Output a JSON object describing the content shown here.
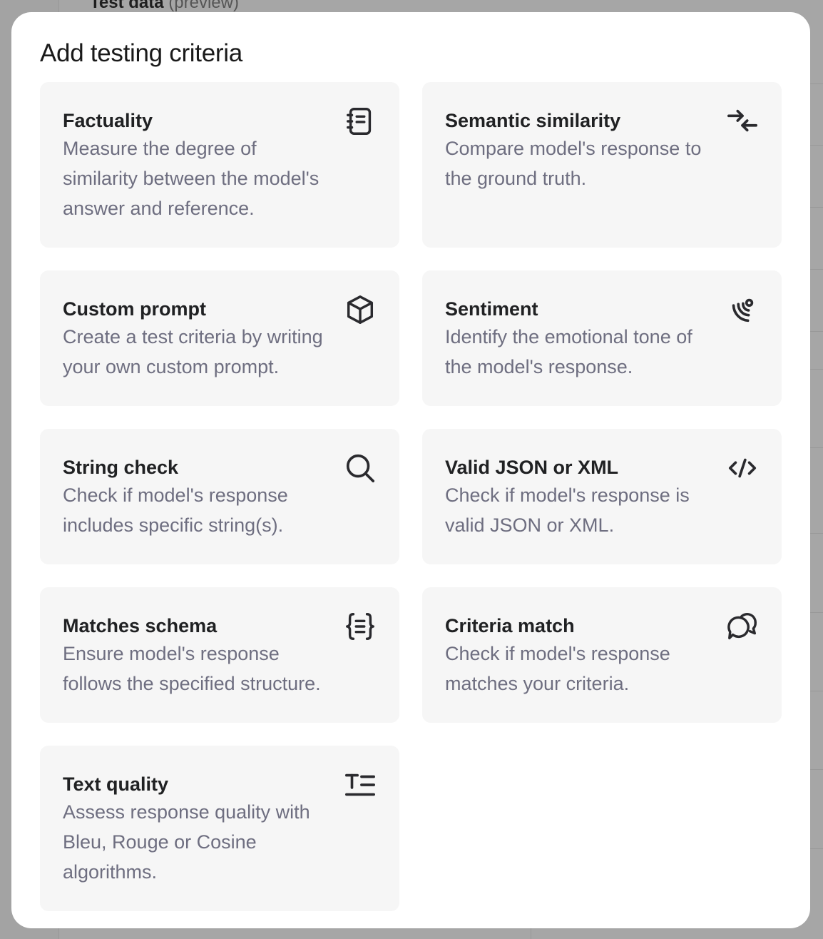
{
  "background": {
    "title": "Test data",
    "title_suffix": "(preview)"
  },
  "modal": {
    "title": "Add testing criteria",
    "cards": [
      {
        "title": "Factuality",
        "description": "Measure the degree of similarity between the model's answer and reference.",
        "icon": "notebook-icon"
      },
      {
        "title": "Semantic similarity",
        "description": "Compare model's response to the ground truth.",
        "icon": "arrows-converge-icon"
      },
      {
        "title": "Custom prompt",
        "description": "Create a test criteria by writing your own custom prompt.",
        "icon": "cube-icon"
      },
      {
        "title": "Sentiment",
        "description": "Identify the emotional tone of the model's response.",
        "icon": "sound-waves-icon"
      },
      {
        "title": "String check",
        "description": "Check if model's response includes specific string(s).",
        "icon": "search-icon"
      },
      {
        "title": "Valid JSON or XML",
        "description": "Check if model's response is valid JSON or XML.",
        "icon": "code-icon"
      },
      {
        "title": "Matches schema",
        "description": "Ensure model's response follows the specified structure.",
        "icon": "braces-icon"
      },
      {
        "title": "Criteria match",
        "description": "Check if model's response matches your criteria.",
        "icon": "chat-bubbles-icon"
      },
      {
        "title": "Text quality",
        "description": "Assess response quality with Bleu, Rouge or Cosine algorithms.",
        "icon": "text-format-icon"
      }
    ]
  }
}
